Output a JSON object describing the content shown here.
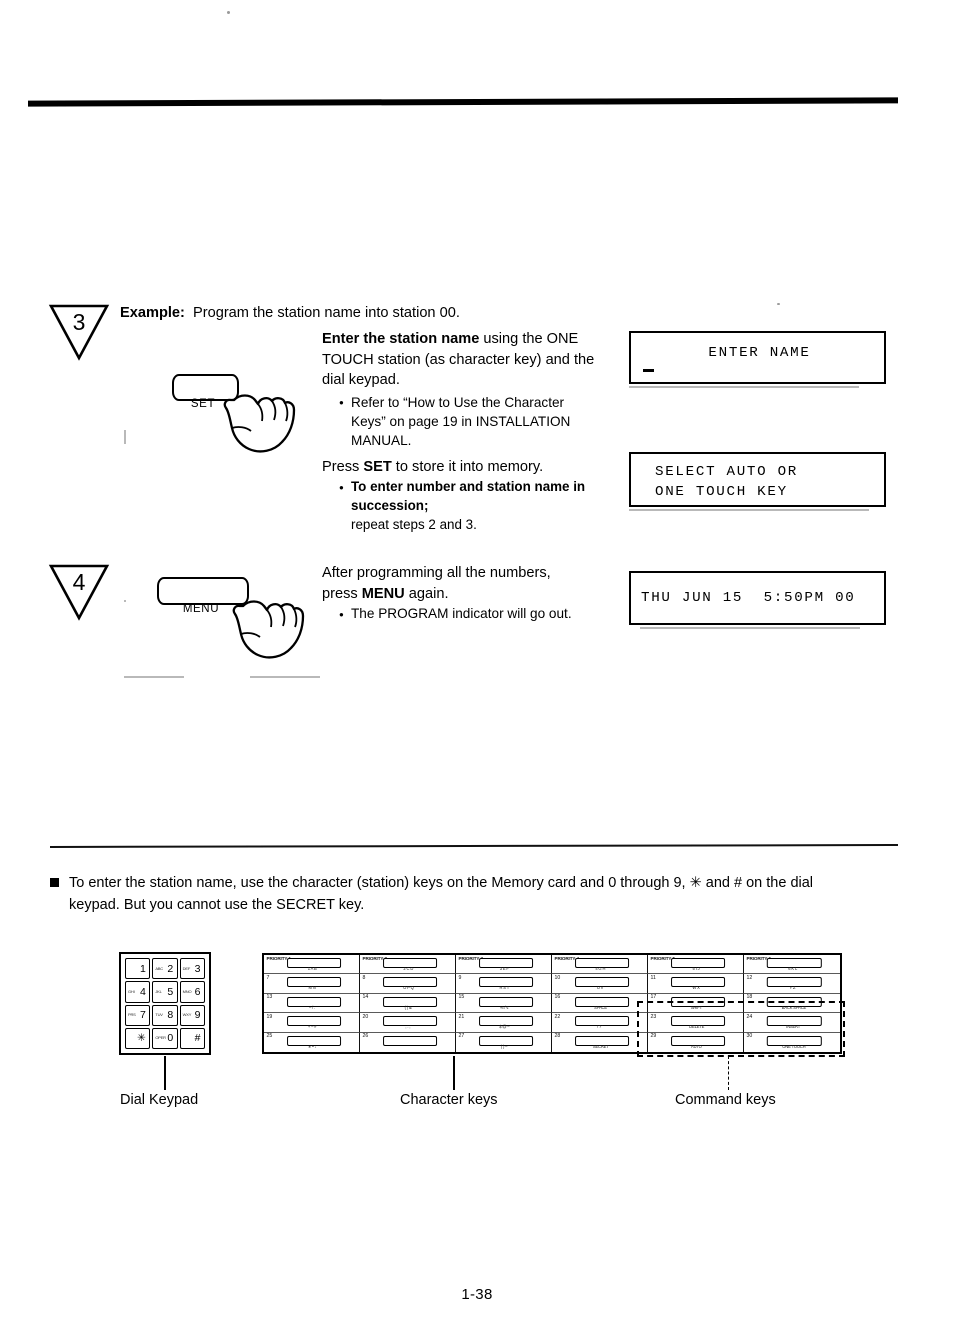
{
  "page": {
    "number": "1-38",
    "rules": {
      "top": true,
      "middle": true
    }
  },
  "steps": [
    {
      "marker": "3",
      "key": {
        "label": "SET",
        "icon": "pointing-hand-icon"
      },
      "example_label": "Example:",
      "example_text": "Program the station name into station 00.",
      "lines": [
        {
          "type": "rich",
          "bold_lead": "Enter the station name",
          "rest": " using the ONE"
        },
        {
          "type": "plain",
          "text": "TOUCH station (as character key) and the"
        },
        {
          "type": "plain",
          "text": "dial keypad."
        },
        {
          "type": "bullet",
          "text": "Refer to “How to Use the Character"
        },
        {
          "type": "indent",
          "text": "Keys” on page 19 in INSTALLATION"
        },
        {
          "type": "indent",
          "text": "MANUAL."
        },
        {
          "type": "rich2",
          "pre": "Press ",
          "bold": "SET",
          "post": " to store it into memory."
        },
        {
          "type": "bullet_bold",
          "text": "To enter number and station name in"
        },
        {
          "type": "indent_bold",
          "text": "succession;"
        },
        {
          "type": "indent",
          "text": "repeat steps 2 and 3."
        }
      ],
      "displays": [
        {
          "line1": "ENTER NAME",
          "line2": "",
          "cursor": true
        },
        {
          "line1": "SELECT AUTO OR",
          "line2": "ONE TOUCH KEY",
          "cursor": false
        }
      ]
    },
    {
      "marker": "4",
      "key": {
        "label": "MENU",
        "icon": "pointing-hand-icon"
      },
      "lines": [
        {
          "type": "plain",
          "text": "After programming all the numbers,"
        },
        {
          "type": "rich3",
          "pre": "press ",
          "bold": "MENU",
          "post": " again."
        },
        {
          "type": "bullet",
          "text": "The PROGRAM indicator will go out."
        }
      ],
      "displays": [
        {
          "line1": "THU JUN 15  5:50PM 00",
          "line2": "",
          "cursor": false
        }
      ]
    }
  ],
  "note": {
    "marker": "filled-square-bullet",
    "line1": "To enter the station name, use the character (station) keys on the Memory card and 0 through 9, ✳ and # on the dial",
    "line2": "keypad. But you cannot use the SECRET key."
  },
  "diagram": {
    "callouts": [
      {
        "label": "Dial Keypad",
        "line_style": "solid"
      },
      {
        "label": "Character keys",
        "line_style": "solid"
      },
      {
        "label": "Command keys",
        "line_style": "dashed"
      }
    ],
    "dial_keypad": {
      "name": "dial-keypad",
      "keys": [
        {
          "num": "1",
          "sub": ""
        },
        {
          "num": "2",
          "sub": "ABC"
        },
        {
          "num": "3",
          "sub": "DEF"
        },
        {
          "num": "4",
          "sub": "GHI"
        },
        {
          "num": "5",
          "sub": "JKL"
        },
        {
          "num": "6",
          "sub": "MNO"
        },
        {
          "num": "7",
          "sub": "PRS"
        },
        {
          "num": "8",
          "sub": "TUV"
        },
        {
          "num": "9",
          "sub": "WXY"
        },
        {
          "num": "✳",
          "sub": ""
        },
        {
          "num": "0",
          "sub": "OPER"
        },
        {
          "num": "#",
          "sub": ""
        }
      ]
    },
    "memory_card": {
      "name": "memory-card",
      "rows": [
        [
          {
            "idx": "PRIORITY 1",
            "is_priority": true,
            "cap": "1  A B"
          },
          {
            "idx": "PRIORITY 2",
            "is_priority": true,
            "cap": "2  C D"
          },
          {
            "idx": "PRIORITY 3",
            "is_priority": true,
            "cap": "3  E F"
          },
          {
            "idx": "PRIORITY 4",
            "is_priority": true,
            "cap": "4  G H"
          },
          {
            "idx": "PRIORITY 5",
            "is_priority": true,
            "cap": "5  I J"
          },
          {
            "idx": "PRIORITY 6",
            "is_priority": true,
            "cap": "6  K L"
          }
        ],
        [
          {
            "idx": "7",
            "is_priority": false,
            "cap": "M N"
          },
          {
            "idx": "8",
            "is_priority": false,
            "cap": "O P Q"
          },
          {
            "idx": "9",
            "is_priority": false,
            "cap": "R S T"
          },
          {
            "idx": "10",
            "is_priority": false,
            "cap": "U V"
          },
          {
            "idx": "11",
            "is_priority": false,
            "cap": "W X"
          },
          {
            "idx": "12",
            "is_priority": false,
            "cap": "Y Z"
          }
        ],
        [
          {
            "idx": "13",
            "is_priority": false,
            "cap": "– / ."
          },
          {
            "idx": "14",
            "is_priority": false,
            "cap": "( ) &"
          },
          {
            "idx": "15",
            "is_priority": false,
            "cap": "% / ¢"
          },
          {
            "idx": "16",
            "is_priority": false,
            "cap": "SPACE"
          },
          {
            "idx": "17",
            "is_priority": false,
            "cap": "SHIFT"
          },
          {
            "idx": "18",
            "is_priority": false,
            "cap": "BACK SPACE"
          }
        ],
        [
          {
            "idx": "19",
            "is_priority": false,
            "cap": "+ – #"
          },
          {
            "idx": "20",
            "is_priority": false,
            "cap": ", : ;"
          },
          {
            "idx": "21",
            "is_priority": false,
            "cap": "$ @ –"
          },
          {
            "idx": "22",
            "is_priority": false,
            "cap": "! ? ’"
          },
          {
            "idx": "23",
            "is_priority": false,
            "cap": "DELETE"
          },
          {
            "idx": "24",
            "is_priority": false,
            "cap": "INSERT"
          }
        ],
        [
          {
            "idx": "25",
            "is_priority": false,
            "cap": "∗ • ↓"
          },
          {
            "idx": "26",
            "is_priority": false,
            "cap": ""
          },
          {
            "idx": "27",
            "is_priority": false,
            "cap": "( ) –"
          },
          {
            "idx": "28",
            "is_priority": false,
            "cap": "SECRET"
          },
          {
            "idx": "29",
            "is_priority": false,
            "cap": "AUTO"
          },
          {
            "idx": "30",
            "is_priority": false,
            "cap": "ONE TOUCH"
          }
        ]
      ]
    }
  }
}
